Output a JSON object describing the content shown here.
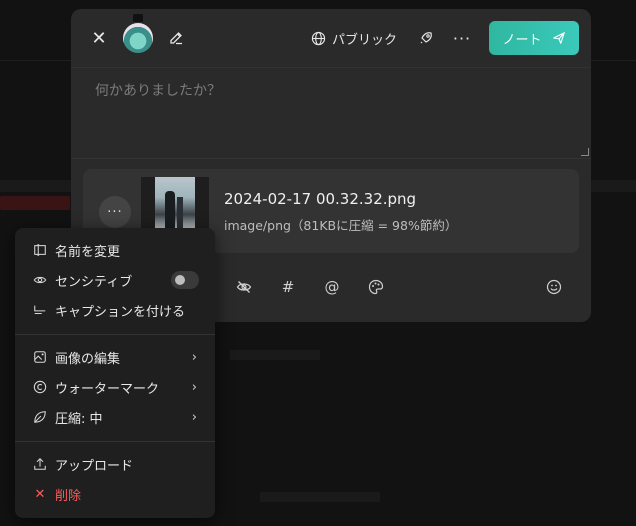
{
  "compose": {
    "visibility_label": "パブリック",
    "note_button_label": "ノート",
    "placeholder": "何かありましたか？"
  },
  "attachment": {
    "filename": "2024-02-17 00.32.32.png",
    "meta": "image/png（81KBに圧縮 = 98%節約）"
  },
  "menu": {
    "rename": "名前を変更",
    "sensitive": "センシティブ",
    "sensitive_on": false,
    "caption": "キャプションを付ける",
    "edit_image": "画像の編集",
    "watermark": "ウォーターマーク",
    "compression": "圧縮: 中",
    "upload": "アップロード",
    "delete": "削除"
  },
  "icons": {
    "close": "close-icon",
    "pen": "pen-icon",
    "globe": "globe-icon",
    "rocket": "rocket-icon",
    "more": "more-icon",
    "send": "send-icon",
    "eye_off": "eye-off-icon",
    "hashtag": "hashtag-icon",
    "mention": "at-icon",
    "palette": "palette-icon",
    "emoji": "emoji-icon"
  },
  "colors": {
    "accent": "#35c0ad",
    "danger": "#ff5a5a",
    "dialog_bg": "#2a2a2a",
    "menu_bg": "#1f1f1f"
  }
}
